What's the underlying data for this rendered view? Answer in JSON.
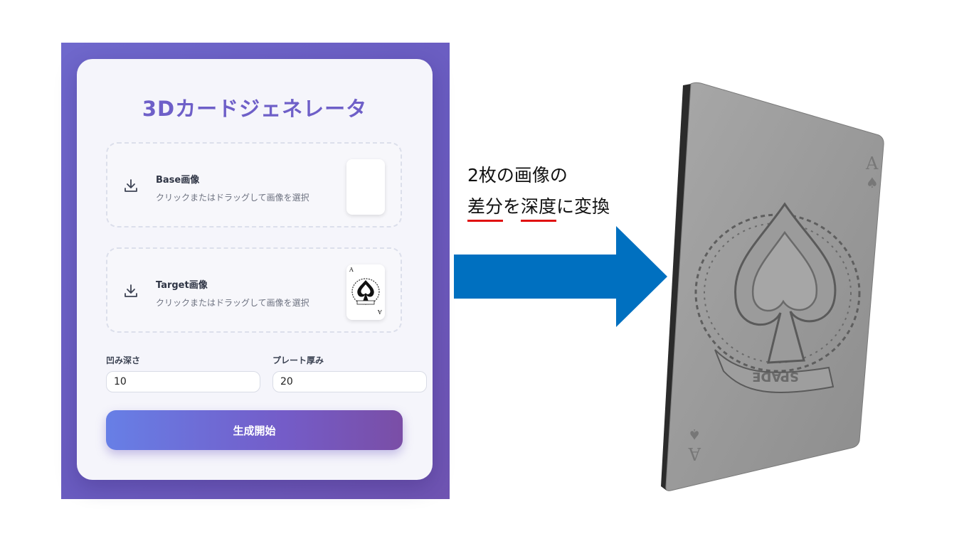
{
  "app": {
    "title": "3Dカードジェネレータ",
    "base_upload": {
      "label": "Base画像",
      "hint": "クリックまたはドラッグして画像を選択"
    },
    "target_upload": {
      "label": "Target画像",
      "hint": "クリックまたはドラッグして画像を選択",
      "preview_card_rank": "A",
      "preview_card_banner": "SPADE"
    },
    "depth_label": "凹み深さ",
    "depth_value": "10",
    "thickness_label": "プレート厚み",
    "thickness_value": "20",
    "generate_button": "生成開始"
  },
  "annotation": {
    "line1": "2枚の画像の",
    "line2_part1": "差分",
    "line2_part2": "を",
    "line2_part3": "深度",
    "line2_part4": "に変換",
    "underline_color": "#e01010",
    "arrow_color": "#0070c0"
  },
  "result_card": {
    "rank": "A",
    "banner": "SPADE"
  },
  "colors": {
    "background_gradient": [
      "#6f68cc",
      "#6f54b2"
    ],
    "title": "#6e5fc8",
    "button_gradient": [
      "#677fe6",
      "#7a4ea6"
    ]
  }
}
